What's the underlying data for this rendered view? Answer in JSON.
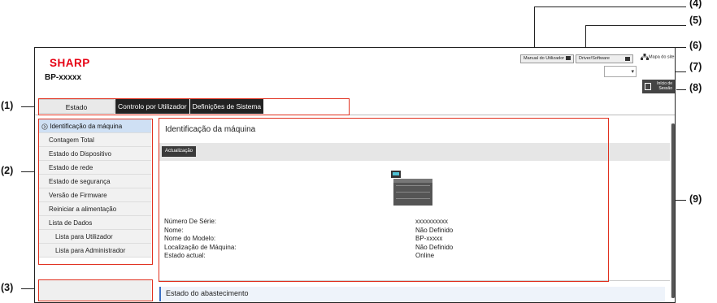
{
  "brand": {
    "logo": "SHARP",
    "model": "BP-xxxxx",
    "brand_color": "#e60012"
  },
  "header": {
    "manual_label": "Manual do Utilizador",
    "driver_label": "Driver/Software",
    "sitemap_label": "Mapa do site",
    "language_value": "",
    "logout_label_1": "Início de",
    "logout_label_2": "Sessão"
  },
  "tabs": [
    {
      "label": "Estado",
      "active": true
    },
    {
      "label": "Controlo por Utilizador",
      "active": false
    },
    {
      "label": "Definições de Sistema",
      "active": false
    }
  ],
  "sidebar": {
    "items": [
      {
        "label": "Identificação da máquina",
        "selected": true
      },
      {
        "label": "Contagem Total"
      },
      {
        "label": "Estado do Dispositivo"
      },
      {
        "label": "Estado de rede"
      },
      {
        "label": "Estado de segurança"
      },
      {
        "label": "Versão de Firmware"
      },
      {
        "label": "Reiniciar a alimentação"
      },
      {
        "label": "Lista de Dados"
      },
      {
        "label": "Lista para Utilizador",
        "sub": true
      },
      {
        "label": "Lista para Administrador",
        "sub": true
      }
    ]
  },
  "content": {
    "title": "Identificação da máquina",
    "update_label": "Actualização",
    "info_labels": [
      "Número De Série:",
      "Nome:",
      "Nome do Modelo:",
      "Localização de Máquina:",
      "Estado actual:"
    ],
    "info_values": [
      "xxxxxxxxxx",
      "Não Definido",
      "BP-xxxxx",
      "Não Definido",
      "Online"
    ],
    "supply_title": "Estado do abastecimento"
  },
  "callouts": [
    "(1)",
    "(2)",
    "(3)",
    "(4)",
    "(5)",
    "(6)",
    "(7)",
    "(8)",
    "(9)"
  ],
  "icons": {
    "manual": "book-icon",
    "driver": "download-icon",
    "sitemap": "sitemap-icon",
    "logout": "logout-icon",
    "selected_item": "chevron-right-icon"
  },
  "colors": {
    "callout_box": "#e0301e",
    "accent": "#3a6fc4"
  }
}
